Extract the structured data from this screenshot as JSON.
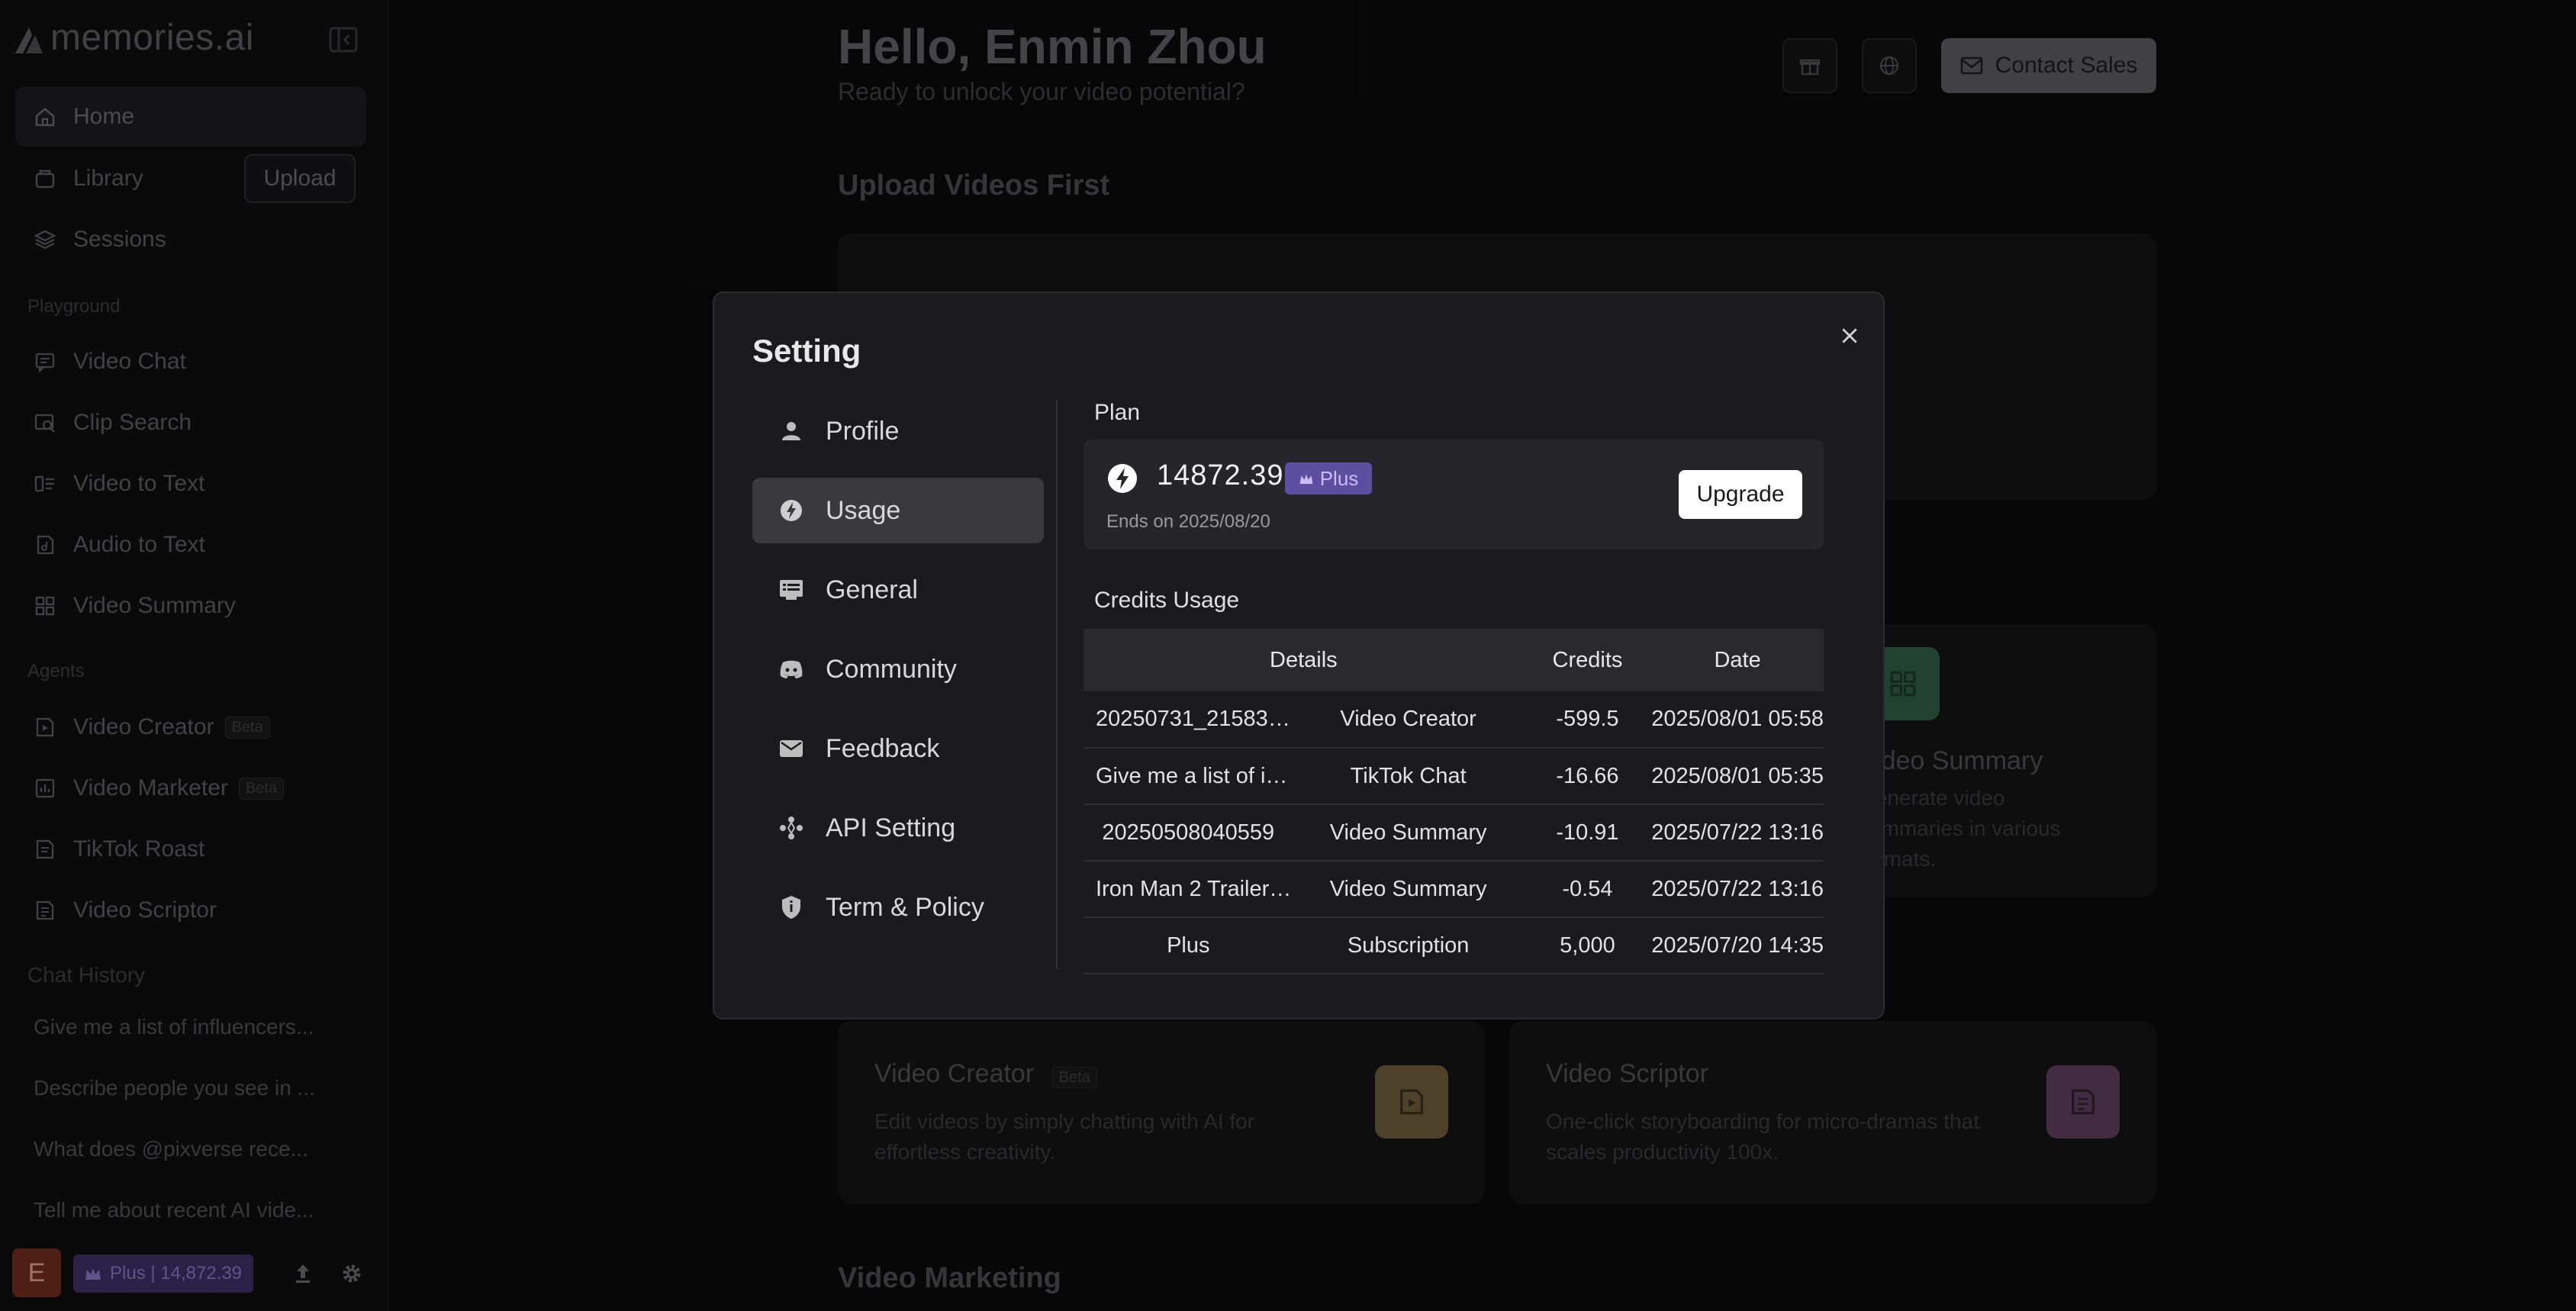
{
  "app": {
    "logo_text": "memories.ai"
  },
  "sidebar": {
    "nav": [
      {
        "label": "Home",
        "icon": "home-icon"
      },
      {
        "label": "Library",
        "icon": "library-icon"
      },
      {
        "label": "Sessions",
        "icon": "sessions-icon"
      }
    ],
    "upload_label": "Upload",
    "playground_label": "Playground",
    "playground": [
      {
        "label": "Video Chat",
        "icon": "chat-icon"
      },
      {
        "label": "Clip Search",
        "icon": "clip-search-icon"
      },
      {
        "label": "Video to Text",
        "icon": "video-text-icon"
      },
      {
        "label": "Audio to Text",
        "icon": "audio-text-icon"
      },
      {
        "label": "Video Summary",
        "icon": "summary-icon"
      }
    ],
    "agents_label": "Agents",
    "agents": [
      {
        "label": "Video Creator",
        "beta": "Beta"
      },
      {
        "label": "Video Marketer",
        "beta": "Beta"
      },
      {
        "label": "TikTok Roast"
      },
      {
        "label": "Video Scriptor"
      }
    ],
    "history_label": "Chat History",
    "history": [
      "Give me a list of influencers...",
      "Describe people you see in ...",
      "What does @pixverse rece...",
      "Tell me about recent AI vide..."
    ],
    "avatar_letter": "E",
    "plan_chip": "Plus | 14,872.39"
  },
  "main": {
    "greeting": "Hello, Enmin Zhou",
    "subtitle": "Ready to unlock your video potential?",
    "contact_label": "Contact Sales",
    "upload_heading": "Upload Videos First",
    "video_marketing_heading": "Video Marketing",
    "cards": {
      "summary_title": "Video Summary",
      "summary_desc": "Generate video summaries in various formats.",
      "creator_title": "Video Creator",
      "creator_beta": "Beta",
      "creator_desc": "Edit videos by simply chatting with AI for effortless creativity.",
      "scriptor_title": "Video Scriptor",
      "scriptor_desc": "One-click storyboarding for micro-dramas that scales productivity 100x."
    }
  },
  "settings": {
    "title": "Setting",
    "menu": [
      {
        "label": "Profile",
        "icon": "profile-icon"
      },
      {
        "label": "Usage",
        "icon": "usage-icon",
        "active": true
      },
      {
        "label": "General",
        "icon": "general-icon"
      },
      {
        "label": "Community",
        "icon": "discord-icon"
      },
      {
        "label": "Feedback",
        "icon": "mail-icon"
      },
      {
        "label": "API Setting",
        "icon": "api-icon"
      },
      {
        "label": "Term & Policy",
        "icon": "shield-icon"
      }
    ],
    "plan_label": "Plan",
    "credits": "14872.39",
    "plan_badge": "Plus",
    "ends_on": "Ends on 2025/08/20",
    "upgrade_label": "Upgrade",
    "usage_label": "Credits Usage",
    "columns": [
      "Details",
      "Credits",
      "Date"
    ],
    "rows": [
      {
        "name": "20250731_215830...",
        "type": "Video Creator",
        "credits": "-599.5",
        "date": "2025/08/01 05:58"
      },
      {
        "name": "Give me a list of in...",
        "type": "TikTok Chat",
        "credits": "-16.66",
        "date": "2025/08/01 05:35"
      },
      {
        "name": "20250508040559",
        "type": "Video Summary",
        "credits": "-10.91",
        "date": "2025/07/22 13:16"
      },
      {
        "name": "Iron Man 2 Trailer ...",
        "type": "Video Summary",
        "credits": "-0.54",
        "date": "2025/07/22 13:16"
      },
      {
        "name": "Plus",
        "type": "Subscription",
        "credits": "5,000",
        "date": "2025/07/20 14:35"
      }
    ]
  },
  "colors": {
    "accent_purple": "#5d4fa0",
    "overlay": "#0b0b0c"
  }
}
